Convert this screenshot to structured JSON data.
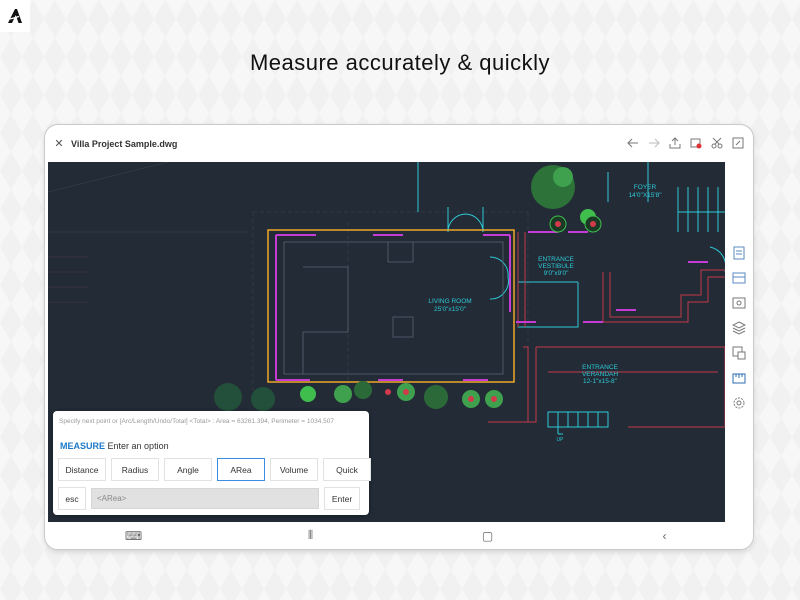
{
  "headline": "Measure accurately & quickly",
  "app": {
    "logo_icon": "autodesk-logo-icon",
    "file_name": "Villa Project Sample.dwg"
  },
  "toolbar_icons": [
    "undo-icon",
    "redo-icon",
    "share-icon",
    "cloud-off-icon",
    "scissors-icon",
    "fullscreen-icon"
  ],
  "rail_icons": [
    "sheets-icon",
    "layouts-icon",
    "view-icon",
    "layers-icon",
    "blocks-icon",
    "measure-icon",
    "settings-icon"
  ],
  "drawing": {
    "foyer": "FOYER",
    "foyer_dim": "14'0\"X15'8\"",
    "vestibule": "ENTRANCE",
    "vestibule2": "VESTIBULE",
    "vestibule_dim": "9'0\"x9'0\"",
    "living": "LIVING ROOM",
    "living_dim": "25'0\"x15'0\"",
    "verandah": "ENTRANCE",
    "verandah2": "VERANDAH",
    "verandah_dim": "12-1\"x15-8\"",
    "up": "UP"
  },
  "measure": {
    "hint": "Specify next point or [Arc/Length/Undo/Total] <Total> : Area = 63261.394, Perimeter = 1034.507",
    "command_keyword": "MEASURE",
    "command_text": "Enter an option",
    "options": [
      "Distance",
      "Radius",
      "Angle",
      "ARea",
      "Volume",
      "Quick"
    ],
    "active_option": "ARea",
    "esc_label": "esc",
    "input_placeholder": "<ARea>",
    "enter_label": "Enter"
  },
  "colors": {
    "canvas": "#222b36",
    "wall_cyan": "#2fc9d8",
    "wall_magenta": "#c63ad6",
    "wall_red": "#c23a4a",
    "selection": "#f0a728",
    "accent": "#1e78c8"
  }
}
